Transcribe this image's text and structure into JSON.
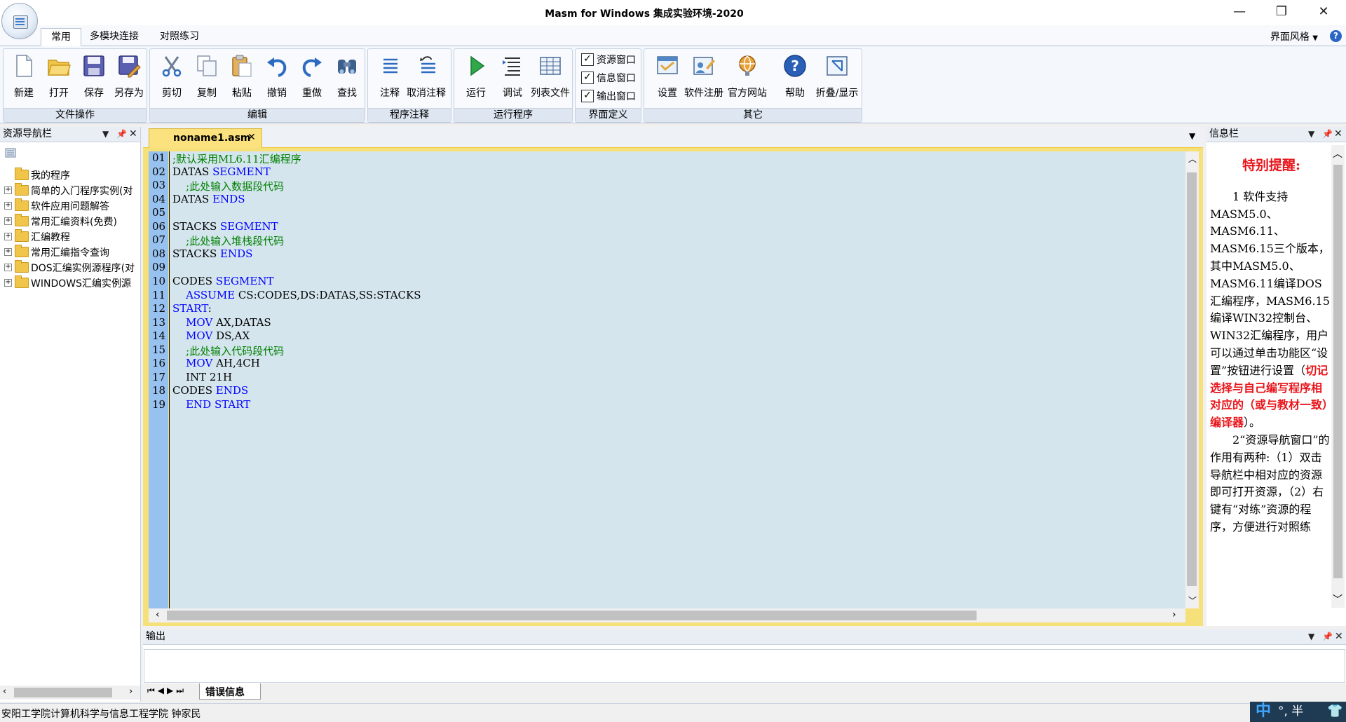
{
  "window": {
    "title": "Masm for Windows 集成实验环境-2020",
    "controls": [
      "—",
      "❐",
      "✕"
    ]
  },
  "ribbon_tabs": [
    "常用",
    "多模块连接",
    "对照练习"
  ],
  "style_menu": "界面风格",
  "groups": {
    "file": {
      "label": "文件操作",
      "tools": [
        "新建",
        "打开",
        "保存",
        "另存为"
      ]
    },
    "edit": {
      "label": "编辑",
      "tools": [
        "剪切",
        "复制",
        "粘贴",
        "撤销",
        "重做",
        "查找"
      ]
    },
    "comment": {
      "label": "程序注释",
      "tools": [
        "注释",
        "取消注释"
      ]
    },
    "run": {
      "label": "运行程序",
      "tools": [
        "运行",
        "调试",
        "列表文件"
      ]
    },
    "ui": {
      "label": "界面定义",
      "checks": [
        "资源窗口",
        "信息窗口",
        "输出窗口"
      ]
    },
    "other": {
      "label": "其它",
      "tools": [
        "设置",
        "软件注册",
        "官方网站",
        "帮助",
        "折叠/显示"
      ]
    }
  },
  "nav": {
    "title": "资源导航栏",
    "items": [
      "我的程序",
      "简单的入门程序实例(对",
      "软件应用问题解答",
      "常用汇编资料(免费)",
      "汇编教程",
      "常用汇编指令查询",
      "DOS汇编实例源程序(对",
      "WINDOWS汇编实例源"
    ]
  },
  "editor": {
    "tab": "noname1.asm",
    "line_numbers": [
      "01",
      "02",
      "03",
      "04",
      "05",
      "06",
      "07",
      "08",
      "09",
      "10",
      "11",
      "12",
      "13",
      "14",
      "15",
      "16",
      "17",
      "18",
      "19"
    ],
    "lines": [
      [
        {
          "t": ";默认采用ML6.11汇编程序",
          "c": "cm"
        }
      ],
      [
        {
          "t": "DATAS ",
          "c": ""
        },
        {
          "t": "SEGMENT",
          "c": "kw"
        }
      ],
      [
        {
          "t": "    ;此处输入数据段代码",
          "c": "cm"
        }
      ],
      [
        {
          "t": "DATAS ",
          "c": ""
        },
        {
          "t": "ENDS",
          "c": "kw"
        }
      ],
      [],
      [
        {
          "t": "STACKS ",
          "c": ""
        },
        {
          "t": "SEGMENT",
          "c": "kw"
        }
      ],
      [
        {
          "t": "    ;此处输入堆栈段代码",
          "c": "cm"
        }
      ],
      [
        {
          "t": "STACKS ",
          "c": ""
        },
        {
          "t": "ENDS",
          "c": "kw"
        }
      ],
      [],
      [
        {
          "t": "CODES ",
          "c": ""
        },
        {
          "t": "SEGMENT",
          "c": "kw"
        }
      ],
      [
        {
          "t": "    ",
          "c": ""
        },
        {
          "t": "ASSUME",
          "c": "kw"
        },
        {
          "t": " CS:CODES,DS:DATAS,SS:STACKS",
          "c": ""
        }
      ],
      [
        {
          "t": "START",
          "c": "kw"
        },
        {
          "t": ":",
          "c": ""
        }
      ],
      [
        {
          "t": "    ",
          "c": ""
        },
        {
          "t": "MOV",
          "c": "kw"
        },
        {
          "t": " AX,DATAS",
          "c": ""
        }
      ],
      [
        {
          "t": "    ",
          "c": ""
        },
        {
          "t": "MOV",
          "c": "kw"
        },
        {
          "t": " DS,AX",
          "c": ""
        }
      ],
      [
        {
          "t": "    ;此处输入代码段代码",
          "c": "cm"
        }
      ],
      [
        {
          "t": "    ",
          "c": ""
        },
        {
          "t": "MOV",
          "c": "kw"
        },
        {
          "t": " AH,4CH",
          "c": ""
        }
      ],
      [
        {
          "t": "    INT 21H",
          "c": ""
        }
      ],
      [
        {
          "t": "CODES ",
          "c": ""
        },
        {
          "t": "ENDS",
          "c": "kw"
        }
      ],
      [
        {
          "t": "    ",
          "c": ""
        },
        {
          "t": "END START",
          "c": "kw"
        }
      ]
    ]
  },
  "info": {
    "pane_title": "信息栏",
    "heading": "特别提醒:",
    "p1_a": "1 软件支持MASM5.0、MASM6.11、MASM6.15三个版本，其中MASM5.0、MASM6.11编译DOS汇编程序，MASM6.15 编译WIN32控制台、WIN32汇编程序，用户可以通过单击功能区“设置”按钮进行设置（",
    "p1_red": "切记选择与自己编写程序相对应的（或与教材一致）编译器",
    "p1_b": "）。",
    "p2": "2“资源导航窗口”的作用有两种:（1）双击导航栏中相对应的资源即可打开资源，（2）右键有“对练”资源的程序，方便进行对照练"
  },
  "output": {
    "title": "输出",
    "tab": "错误信息"
  },
  "status": {
    "text": "安阳工学院计算机科学与信息工程学院 钟家民"
  },
  "ime": {
    "text": "中",
    "extra": "°, 半"
  },
  "colors": {
    "editor_bg": "#d4e5ee",
    "keyword": "#0000ff",
    "comment": "#008000",
    "accent_red": "#e8141a",
    "tab_active": "#fbe27e"
  }
}
